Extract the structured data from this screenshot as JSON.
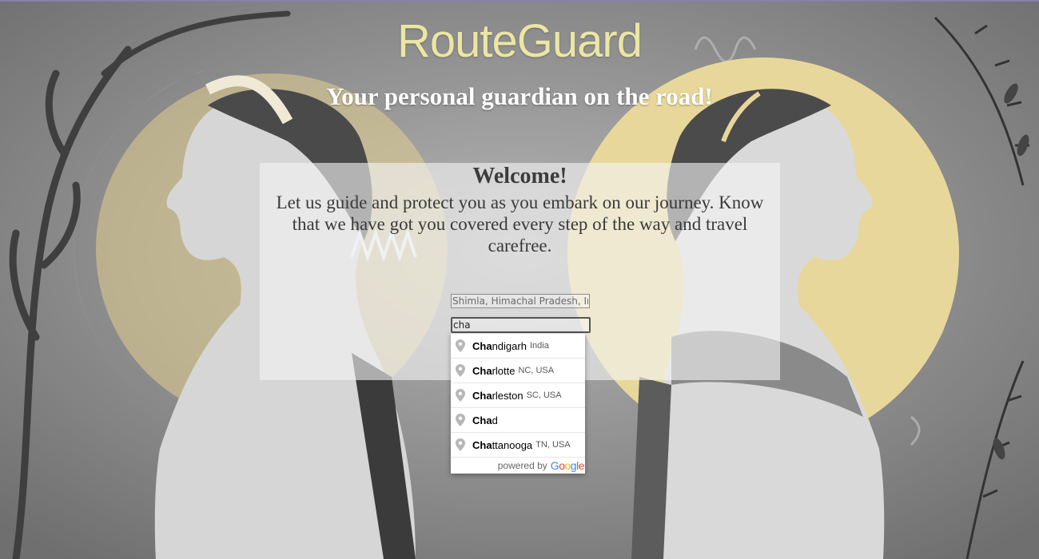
{
  "header": {
    "brand": "RouteGuard",
    "tagline": "Your personal guardian on the road!"
  },
  "welcome": {
    "title": "Welcome!",
    "text": "Let us guide and protect you as you embark on our journey. Know that we have got you covered every step of the way and travel carefree."
  },
  "form": {
    "origin_placeholder": "Shimla, Himachal Pradesh, India",
    "destination_value": "cha"
  },
  "autocomplete": {
    "items": [
      {
        "match": "Ch",
        "bold2": "a",
        "rest": "ndigarh",
        "secondary": "India"
      },
      {
        "match": "Cha",
        "bold2": "",
        "rest": "rlotte",
        "secondary": "NC, USA"
      },
      {
        "match": "Cha",
        "bold2": "",
        "rest": "rleston",
        "secondary": "SC, USA"
      },
      {
        "match": "Cha",
        "bold2": "",
        "rest": "d",
        "secondary": ""
      },
      {
        "match": "Cha",
        "bold2": "",
        "rest": "ttanooga",
        "secondary": "TN, USA"
      }
    ],
    "powered_by": "powered by",
    "google": [
      "G",
      "o",
      "o",
      "g",
      "l",
      "e"
    ],
    "google_colors": [
      "#4285F4",
      "#EA4335",
      "#FBBC05",
      "#4285F4",
      "#34A853",
      "#EA4335"
    ]
  },
  "icons": {
    "pin": "map-pin-icon"
  },
  "colors": {
    "brand": "#ebe6a3",
    "tagline": "#ffffff",
    "background": "#8c8c8c",
    "sun": "#e8d79a"
  }
}
